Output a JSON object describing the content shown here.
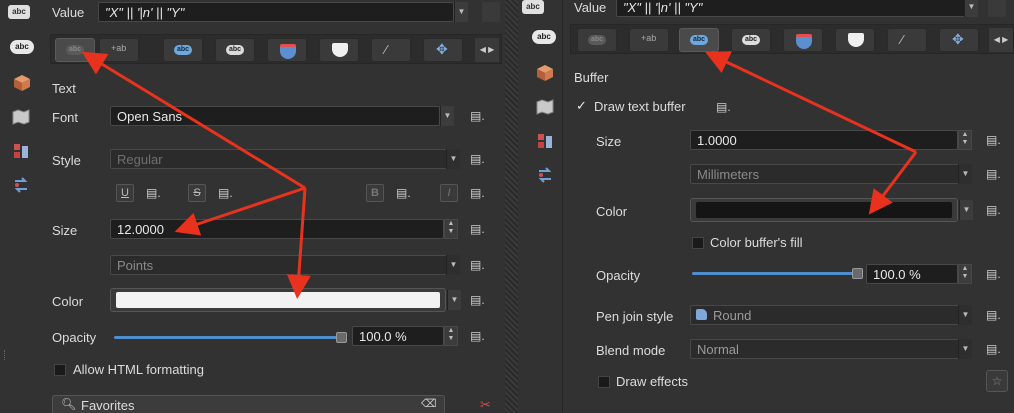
{
  "left": {
    "value_label": "Value",
    "value_expr": "\"X\" || '|n' || \"Y\"",
    "section_title": "Text",
    "font_label": "Font",
    "font_value": "Open Sans",
    "style_label": "Style",
    "style_value": "Regular",
    "underline": "U",
    "strike": "S",
    "bold": "B",
    "italic": "I",
    "size_label": "Size",
    "size_value": "12.0000",
    "units_value": "Points",
    "color_label": "Color",
    "text_color": "#f2f2f2",
    "opacity_label": "Opacity",
    "opacity_value": "100.0 %",
    "opacity_fraction": 1.0,
    "allow_html_label": "Allow HTML formatting",
    "favorites_placeholder": "Favorites"
  },
  "right": {
    "value_label": "Value",
    "value_expr": "\"X\" || '|n' || \"Y\"",
    "section_title": "Buffer",
    "draw_buffer_label": "Draw text buffer",
    "draw_buffer_checked": true,
    "check_mark": "✓",
    "size_label": "Size",
    "size_value": "1.0000",
    "units_value": "Millimeters",
    "color_label": "Color",
    "buffer_color": "#151515",
    "color_fill_label": "Color buffer's fill",
    "opacity_label": "Opacity",
    "opacity_value": "100.0 %",
    "opacity_fraction": 1.0,
    "pen_join_label": "Pen join style",
    "pen_join_value": "Round",
    "blend_label": "Blend mode",
    "blend_value": "Normal",
    "draw_effects_label": "Draw effects"
  },
  "tab_icons": [
    "text-tab-icon",
    "formatting-tab-icon",
    "buffer-tab-icon",
    "mask-tab-icon",
    "background-tab-icon",
    "shadow-tab-icon",
    "callout-tab-icon",
    "placement-tab-icon"
  ],
  "side_icons": [
    "labels-icon",
    "3d-icon",
    "map-icon",
    "rendering-icon",
    "diagram-icon"
  ],
  "pill_text": "abc",
  "accent": "#4f8fd0",
  "arrow_color": "#e8321e"
}
